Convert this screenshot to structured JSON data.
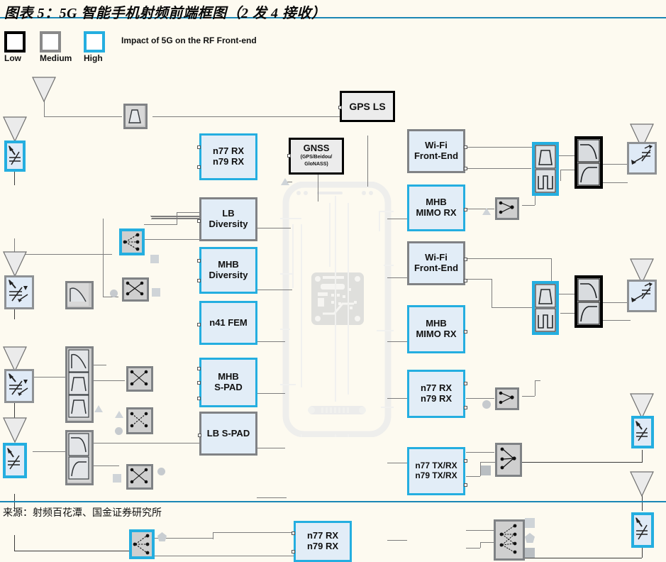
{
  "title": "图表 5：5G 智能手机射频前端框图（2 发 4 接收）",
  "source": "来源：射频百花潭、国金证券研究所",
  "colors": {
    "accent_rule": "#1b87b5",
    "high": "#24aee0",
    "medium": "#808285",
    "low": "#000000",
    "block_fill": "#e2edf7",
    "page_bg": "#fdfaf0",
    "wire": "#7d7d7d"
  },
  "legend": {
    "caption": "Impact of 5G on the RF Front-end",
    "items": [
      {
        "label": "Low",
        "level": "low",
        "color": "#000000"
      },
      {
        "label": "Medium",
        "level": "medium",
        "color": "#8a8a8a"
      },
      {
        "label": "High",
        "level": "high",
        "color": "#24aee0"
      }
    ]
  },
  "blocks": {
    "left_column": [
      {
        "id": "n77-n79-rx-left",
        "lines": [
          "n77 RX",
          "n79 RX"
        ],
        "level": "high"
      },
      {
        "id": "lb-diversity",
        "lines": [
          "LB",
          "Diversity"
        ],
        "level": "medium"
      },
      {
        "id": "mhb-diversity",
        "lines": [
          "MHB",
          "Diversity"
        ],
        "level": "high"
      },
      {
        "id": "n41-fem",
        "lines": [
          "n41 FEM"
        ],
        "level": "high"
      },
      {
        "id": "mhb-s-pad",
        "lines": [
          "MHB",
          "S-PAD"
        ],
        "level": "high"
      },
      {
        "id": "lb-s-pad",
        "lines": [
          "LB S-PAD"
        ],
        "level": "medium"
      }
    ],
    "center": [
      {
        "id": "gps-ls",
        "lines": [
          "GPS LS"
        ],
        "level": "low"
      },
      {
        "id": "gnss",
        "lines": [
          "GNSS"
        ],
        "sub": [
          "(GPS/Beidou/",
          "GloNASS)"
        ],
        "level": "low"
      }
    ],
    "right_column": [
      {
        "id": "wifi-front-end-1",
        "lines": [
          "Wi-Fi",
          "Front-End"
        ],
        "level": "medium"
      },
      {
        "id": "mhb-mimo-rx-1",
        "lines": [
          "MHB",
          "MIMO RX"
        ],
        "level": "high"
      },
      {
        "id": "wifi-front-end-2",
        "lines": [
          "Wi-Fi",
          "Front-End"
        ],
        "level": "medium"
      },
      {
        "id": "mhb-mimo-rx-2",
        "lines": [
          "MHB",
          "MIMO RX"
        ],
        "level": "high"
      },
      {
        "id": "n77-n79-rx-right",
        "lines": [
          "n77 RX",
          "n79 RX"
        ],
        "level": "high"
      },
      {
        "id": "n77-n79-txrx",
        "lines": [
          "n77 TX/RX",
          "n79 TX/RX"
        ],
        "level": "high"
      }
    ],
    "bottom": [
      {
        "id": "n77-n79-rx-bottom",
        "lines": [
          "n77 RX",
          "n79 RX"
        ],
        "level": "high"
      }
    ]
  },
  "components": {
    "antennas": 10,
    "antenna_tuners": 8,
    "filters": 10,
    "switches": 9,
    "phone_illustration": "smartphone-with-rf-board"
  }
}
